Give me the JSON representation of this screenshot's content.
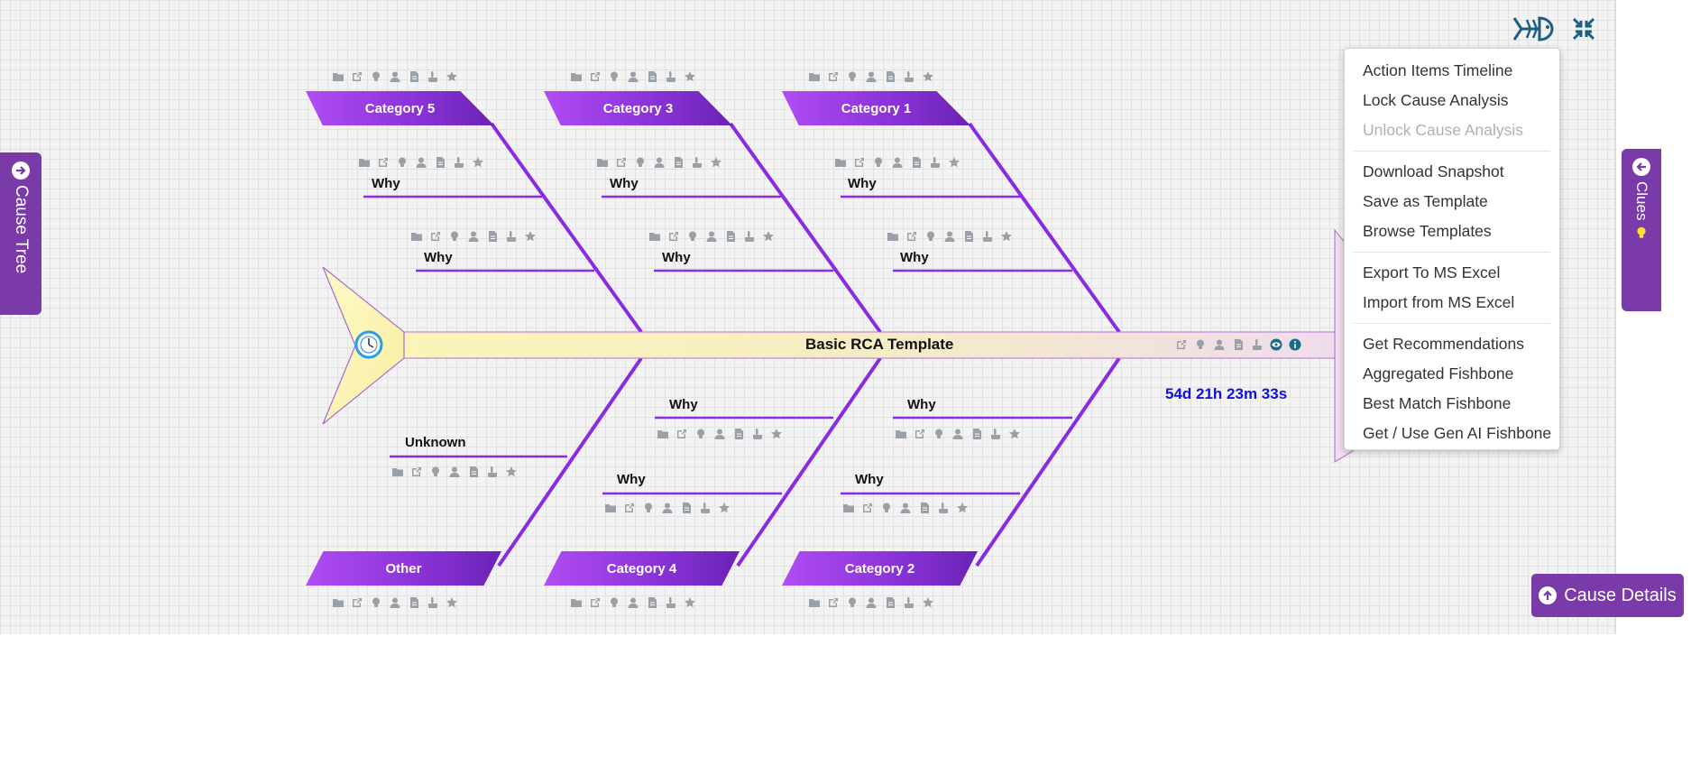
{
  "title": "Basic RCA Template",
  "timer": "54d 21h 23m 33s",
  "categories": {
    "c5": "Category 5",
    "c3": "Category 3",
    "c1": "Category 1",
    "other": "Other",
    "c4": "Category 4",
    "c2": "Category 2"
  },
  "causes": {
    "why": "Why",
    "unknown": "Unknown"
  },
  "side": {
    "cause_tree": "Cause Tree",
    "clues": "Clues"
  },
  "menu": {
    "action_items_timeline": "Action Items Timeline",
    "lock_cause_analysis": "Lock Cause Analysis",
    "unlock_cause_analysis": "Unlock Cause Analysis",
    "download_snapshot": "Download Snapshot",
    "save_as_template": "Save as Template",
    "browse_templates": "Browse Templates",
    "export_excel": "Export To MS Excel",
    "import_excel": "Import from MS Excel",
    "get_recommendations": "Get Recommendations",
    "aggregated_fishbone": "Aggregated Fishbone",
    "best_match_fishbone": "Best Match Fishbone",
    "gen_ai_fishbone": "Get / Use Gen AI Fishbone"
  },
  "cause_details_button": "Cause Details",
  "icon_set": [
    "folder-icon",
    "external-link-icon",
    "lightbulb-icon",
    "user-icon",
    "document-icon",
    "hand-icon",
    "star-icon"
  ],
  "colors": {
    "accent": "#7a3aa8",
    "bone": "#8a2be2",
    "timer": "#1010d8",
    "icon_gray": "#9aa0a8"
  }
}
